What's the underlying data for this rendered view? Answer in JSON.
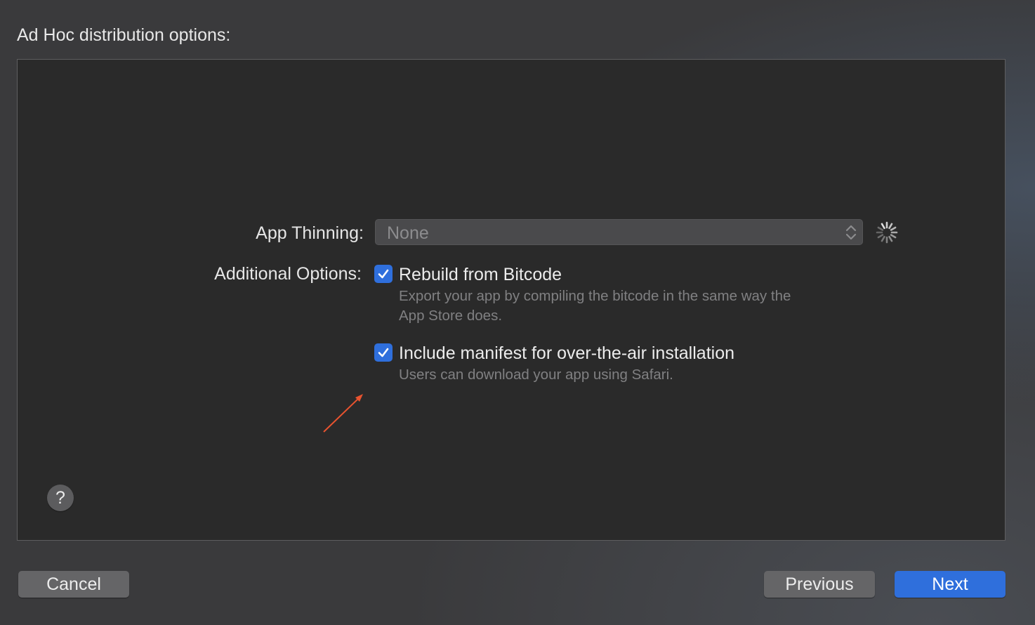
{
  "dialog": {
    "title": "Ad Hoc distribution options:"
  },
  "app_thinning": {
    "label": "App Thinning:",
    "value": "None",
    "loading_icon": "spinner-icon"
  },
  "additional_options": {
    "label": "Additional Options:",
    "options": [
      {
        "title": "Rebuild from Bitcode",
        "description_line1": "Export your app by compiling the bitcode in the same way the",
        "description_line2": "App Store does.",
        "checked": true
      },
      {
        "title": "Include manifest for over-the-air installation",
        "description_line1": "Users can download your app using Safari.",
        "checked": true
      }
    ]
  },
  "help": {
    "label": "?"
  },
  "buttons": {
    "cancel": "Cancel",
    "previous": "Previous",
    "next": "Next"
  },
  "colors": {
    "accent": "#2f6fdc",
    "annotation_arrow": "#e8532f"
  }
}
